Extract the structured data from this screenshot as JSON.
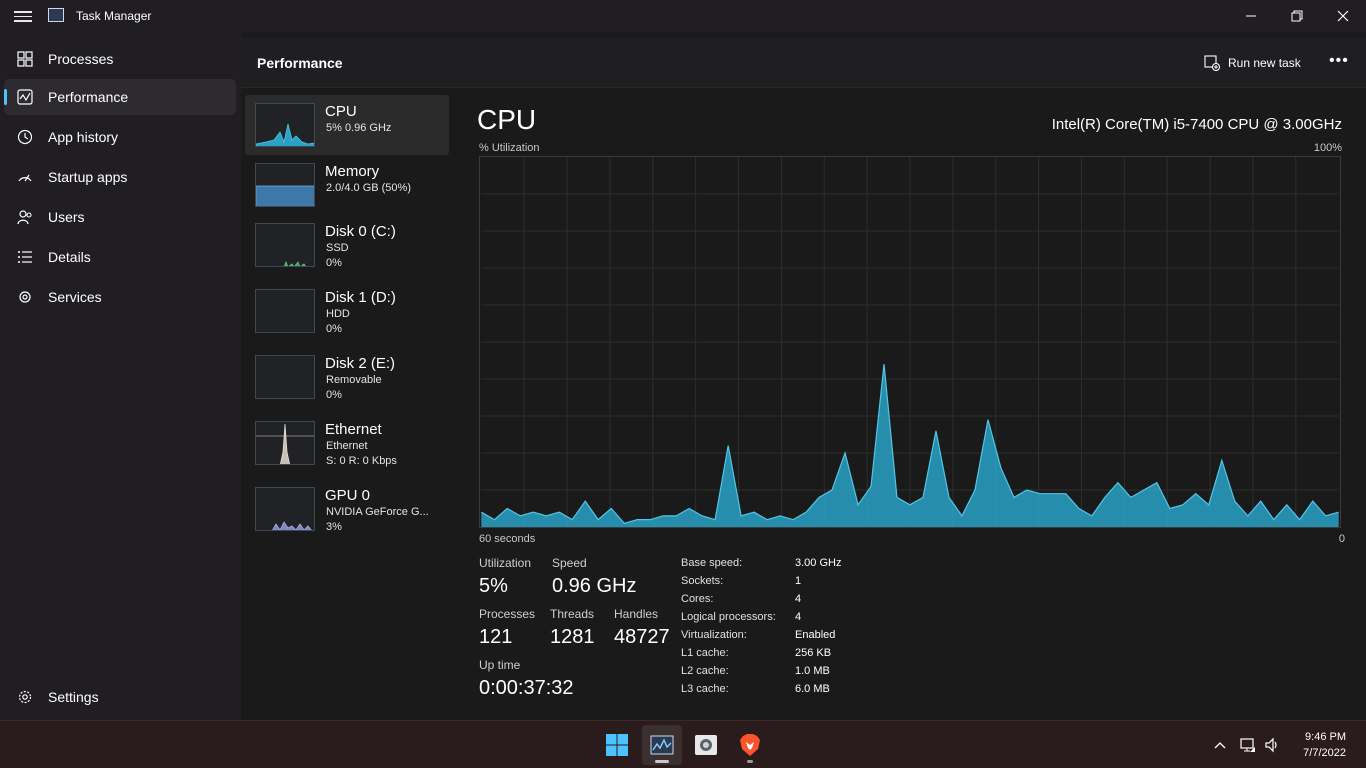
{
  "window": {
    "title": "Task Manager"
  },
  "sidebar": {
    "items": [
      {
        "label": "Processes",
        "icon": "processes-icon"
      },
      {
        "label": "Performance",
        "icon": "performance-icon"
      },
      {
        "label": "App history",
        "icon": "app-history-icon"
      },
      {
        "label": "Startup apps",
        "icon": "startup-apps-icon"
      },
      {
        "label": "Users",
        "icon": "users-icon"
      },
      {
        "label": "Details",
        "icon": "details-icon"
      },
      {
        "label": "Services",
        "icon": "services-icon"
      }
    ],
    "settings_label": "Settings"
  },
  "header": {
    "title": "Performance",
    "run_new_task": "Run new task"
  },
  "devices": [
    {
      "name": "CPU",
      "line1": "5% 0.96 GHz",
      "line2": ""
    },
    {
      "name": "Memory",
      "line1": "2.0/4.0 GB (50%)",
      "line2": ""
    },
    {
      "name": "Disk 0 (C:)",
      "line1": "SSD",
      "line2": "0%"
    },
    {
      "name": "Disk 1 (D:)",
      "line1": "HDD",
      "line2": "0%"
    },
    {
      "name": "Disk 2 (E:)",
      "line1": "Removable",
      "line2": "0%"
    },
    {
      "name": "Ethernet",
      "line1": "Ethernet",
      "line2": "S: 0 R: 0 Kbps"
    },
    {
      "name": "GPU 0",
      "line1": "NVIDIA GeForce G...",
      "line2": "3%"
    }
  ],
  "cpu": {
    "title": "CPU",
    "model": "Intel(R) Core(TM) i5-7400 CPU @ 3.00GHz",
    "util_label": "% Utilization",
    "max_label": "100%",
    "time_label": "60 seconds",
    "min_label": "0",
    "history": [
      4,
      2,
      5,
      3,
      4,
      3,
      4,
      2,
      7,
      2,
      5,
      1,
      2,
      2,
      3,
      3,
      5,
      3,
      2,
      22,
      3,
      4,
      2,
      3,
      2,
      4,
      8,
      10,
      20,
      6,
      11,
      44,
      8,
      6,
      8,
      26,
      8,
      3,
      10,
      29,
      16,
      8,
      10,
      9,
      9,
      9,
      5,
      3,
      8,
      12,
      8,
      10,
      12,
      5,
      6,
      9,
      6,
      18,
      7,
      3,
      7,
      2,
      6,
      2,
      7,
      3,
      4
    ],
    "stats": {
      "utilization_label": "Utilization",
      "utilization": "5%",
      "speed_label": "Speed",
      "speed": "0.96 GHz",
      "processes_label": "Processes",
      "processes": "121",
      "threads_label": "Threads",
      "threads": "1281",
      "handles_label": "Handles",
      "handles": "48727",
      "uptime_label": "Up time",
      "uptime": "0:00:37:32"
    },
    "specs": [
      {
        "label": "Base speed:",
        "value": "3.00 GHz"
      },
      {
        "label": "Sockets:",
        "value": "1"
      },
      {
        "label": "Cores:",
        "value": "4"
      },
      {
        "label": "Logical processors:",
        "value": "4"
      },
      {
        "label": "Virtualization:",
        "value": "Enabled"
      },
      {
        "label": "L1 cache:",
        "value": "256 KB"
      },
      {
        "label": "L2 cache:",
        "value": "1.0 MB"
      },
      {
        "label": "L3 cache:",
        "value": "6.0 MB"
      }
    ]
  },
  "taskbar": {
    "time": "9:46 PM",
    "date": "7/7/2022"
  },
  "colors": {
    "accent": "#4cc2ff",
    "graph_fill": "#2aa2c8",
    "graph_stroke": "#52c6e6",
    "memory_fill": "#3f78a8"
  }
}
